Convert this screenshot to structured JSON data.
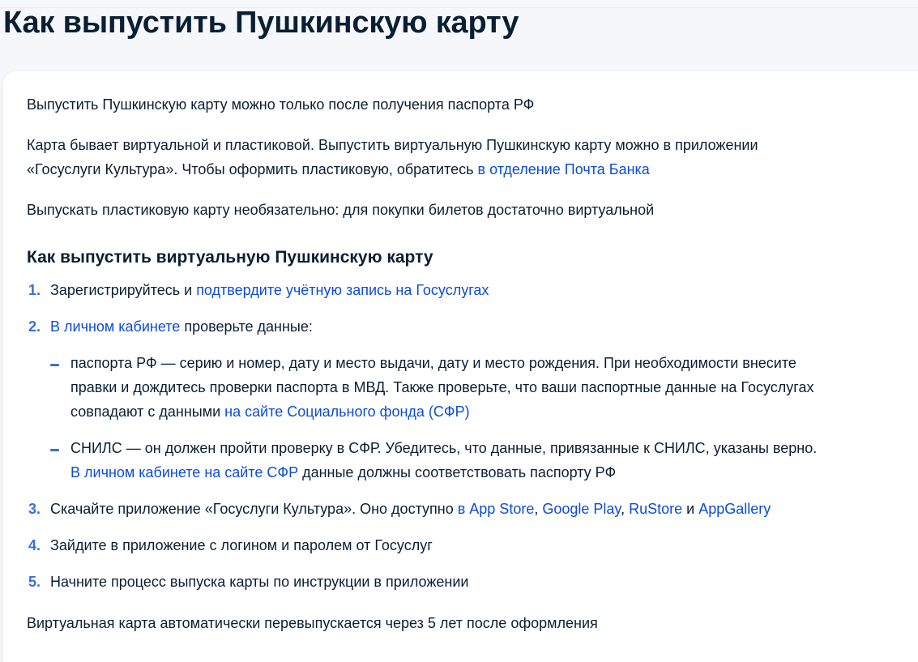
{
  "page_title": "Как выпустить Пушкинскую карту",
  "intro": {
    "p1": "Выпустить Пушкинскую карту можно только после получения паспорта РФ",
    "p2_line1": "Карта бывает виртуальной и пластиковой. Выпустить виртуальную Пушкинскую карту можно в приложении",
    "p2_line2_text": "«Госуслуги Культура». Чтобы оформить пластиковую, обратитесь ",
    "p2_link": "в отделение Почта Банка",
    "p3": "Выпускать пластиковую карту необязательно: для покупки билетов достаточно виртуальной"
  },
  "section": {
    "heading": "Как выпустить виртуальную Пушкинскую карту",
    "steps": [
      {
        "num": "1.",
        "text_before": "Зарегистрируйтесь и ",
        "link": "подтвердите учётную запись на Госуслугах"
      },
      {
        "num": "2.",
        "link": "В личном кабинете",
        "text_after": " проверьте данные:",
        "subitems": [
          {
            "line1": "паспорта РФ — серию и номер, дату и место выдачи, дату и место рождения. При необходимости внесите",
            "line2": "правки и дождитесь проверки паспорта в МВД. Также проверьте, что ваши паспортные данные на Госуслугах",
            "line3_text": "совпадают с данными ",
            "line3_link": "на сайте Социального фонда (СФР)"
          },
          {
            "line1": "СНИЛС — он должен пройти проверку в СФР. Убедитесь, что данные, привязанные к СНИЛС, указаны верно.",
            "line2_link": "В личном кабинете на сайте СФР",
            "line2_text": " данные должны соответствовать паспорту РФ"
          }
        ]
      },
      {
        "num": "3.",
        "text_before": "Скачайте приложение «Госуслуги Культура». Оно доступно ",
        "link_appstore": "в App Store",
        "sep1": ", ",
        "link_googleplay": "Google Play",
        "sep2": ", ",
        "link_rustore": "RuStore",
        "sep3": " и ",
        "link_appgallery": "AppGallery"
      },
      {
        "num": "4.",
        "text": "Зайдите в приложение с логином и паролем от Госуслуг"
      },
      {
        "num": "5.",
        "text": "Начните процесс выпуска карты по инструкции в приложении"
      }
    ],
    "footer": "Виртуальная карта автоматически перевыпускается через 5 лет после оформления"
  },
  "colors": {
    "text": "#0b1f33",
    "link": "#0d4cd3",
    "marker": "#3a6fd8",
    "page_bg": "#f5f7fb",
    "card_bg": "#ffffff"
  }
}
